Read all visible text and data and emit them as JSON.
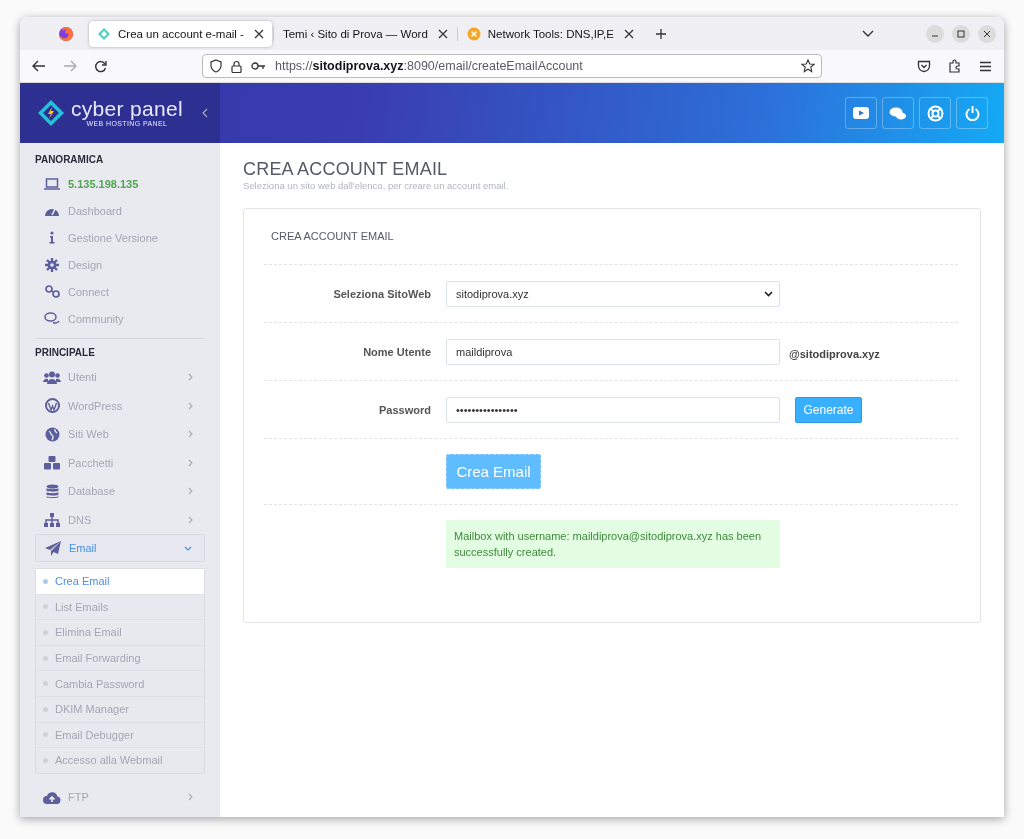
{
  "browser": {
    "tabs": [
      {
        "title": "Crea un account e-mail -",
        "selected": true
      },
      {
        "title": "Temi ‹ Sito di Prova — Word",
        "selected": false
      },
      {
        "title": "Network Tools: DNS,IP,E",
        "selected": false
      }
    ],
    "url": "https://**sitodiprova.xyz**:8090/email/createEmailAccount"
  },
  "sidebar": {
    "logo": {
      "name": "cyber panel",
      "tagline": "WEB HOSTING PANEL"
    },
    "sections": [
      {
        "title": "PANORAMICA",
        "items": [
          {
            "label": "5.135.198.135",
            "kind": "ip"
          },
          {
            "label": "Dashboard",
            "kind": "link"
          },
          {
            "label": "Gestione Versione",
            "kind": "link"
          },
          {
            "label": "Design",
            "kind": "link"
          },
          {
            "label": "Connect",
            "kind": "link"
          },
          {
            "label": "Community",
            "kind": "link"
          }
        ]
      },
      {
        "title": "PRINCIPALE",
        "items": [
          {
            "label": "Utenti",
            "kind": "menu",
            "expanded": false
          },
          {
            "label": "WordPress",
            "kind": "menu",
            "expanded": false
          },
          {
            "label": "Siti Web",
            "kind": "menu",
            "expanded": false
          },
          {
            "label": "Pacchetti",
            "kind": "menu",
            "expanded": false
          },
          {
            "label": "Database",
            "kind": "menu",
            "expanded": false
          },
          {
            "label": "DNS",
            "kind": "menu",
            "expanded": false
          },
          {
            "label": "Email",
            "kind": "menu",
            "expanded": true,
            "children": [
              {
                "label": "Crea Email",
                "selected": true
              },
              {
                "label": "List Emails",
                "selected": false
              },
              {
                "label": "Elimina Email",
                "selected": false
              },
              {
                "label": "Email Forwarding",
                "selected": false
              },
              {
                "label": "Cambia Password",
                "selected": false
              },
              {
                "label": "DKIM Manager",
                "selected": false
              },
              {
                "label": "Email Debugger",
                "selected": false
              },
              {
                "label": "Accesso alla Webmail",
                "selected": false
              }
            ]
          },
          {
            "label": "FTP",
            "kind": "menu",
            "expanded": false
          }
        ]
      }
    ]
  },
  "page": {
    "title": "CREA ACCOUNT EMAIL",
    "subtitle": "Seleziona un sito web dall'elenco, per creare un account email."
  },
  "form": {
    "title": "CREA ACCOUNT EMAIL",
    "fields": [
      {
        "kind": "select",
        "label": "Seleziona SitoWeb",
        "value": "sitodiprova.xyz"
      },
      {
        "kind": "text",
        "label": "Nome Utente",
        "value": "maildiprova",
        "suffix": "@sitodiprova.xyz"
      },
      {
        "kind": "password",
        "label": "Password",
        "value": "••••••••••••••••",
        "button": "Generate"
      }
    ],
    "submit": "Crea Email",
    "message": "Mailbox with username: maildiprova@sitodiprova.xyz has been successfully created."
  }
}
